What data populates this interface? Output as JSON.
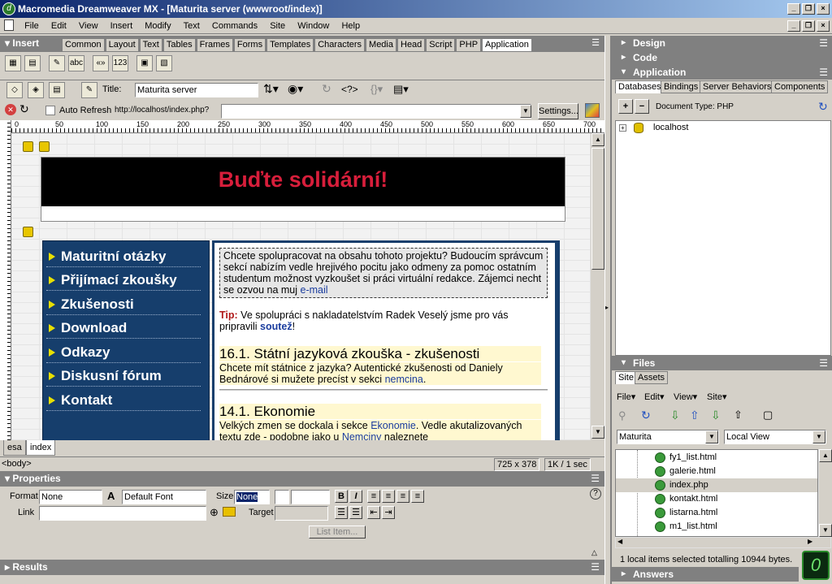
{
  "window": {
    "title": "Macromedia Dreamweaver MX - [Maturita server (wwwroot/index)]"
  },
  "menu": [
    "File",
    "Edit",
    "View",
    "Insert",
    "Modify",
    "Text",
    "Commands",
    "Site",
    "Window",
    "Help"
  ],
  "insert_panel": {
    "label": "Insert",
    "tabs": [
      "Common",
      "Layout",
      "Text",
      "Tables",
      "Frames",
      "Forms",
      "Templates",
      "Characters",
      "Media",
      "Head",
      "Script",
      "PHP",
      "Application"
    ],
    "selected_tab": "Application"
  },
  "doc_toolbar": {
    "title_label": "Title:",
    "title_value": "Maturita server"
  },
  "live_bar": {
    "auto_refresh_label": "Auto Refresh",
    "url": "http://localhost/index.php?",
    "settings_label": "Settings..."
  },
  "ruler": {
    "labels": [
      "0",
      "50",
      "100",
      "150",
      "200",
      "250",
      "300",
      "350",
      "400",
      "450",
      "500",
      "550",
      "600",
      "650",
      "700"
    ]
  },
  "page": {
    "banner_text": "Buďte solidární!",
    "nav": [
      "Maturitní otázky",
      "Přijímací zkoušky",
      "Zkušenosti",
      "Download",
      "Odkazy",
      "Diskusní fórum",
      "Kontakt"
    ],
    "notice_text": "Chcete spolupracovat na obsahu tohoto projektu? Budoucím správcum sekcí nabízím vedle hrejivého pocitu jako odmeny za pomoc ostatním studentum možnost vyzkoušet si práci virtuální redakce. Zájemci necht se ozvou na muj",
    "notice_link": "e-mail",
    "tip_label": "Tip:",
    "tip_text": "Ve spolupráci s nakladatelstvím Radek Veselý jsme pro vás pripravili",
    "tip_link": "soutež",
    "tip_end": "!",
    "news1_title": "16.1. Státní jazyková zkouška - zkušenosti",
    "news1_text": "Chcete mít státnice z jazyka? Autentické zkušenosti od Daniely Bednárové si mužete precíst v sekci",
    "news1_link": "nemcina",
    "news1_end": ".",
    "news2_title": "14.1. Ekonomie",
    "news2_text_a": "Velkých zmen se dockala i sekce",
    "news2_link_a": "Ekonomie",
    "news2_text_b": ". Vedle akutalizovaných textu zde - podobne jako u",
    "news2_link_b": "Nemciny",
    "news2_text_c": "naleznete"
  },
  "doc_tabs": [
    "esa",
    "index"
  ],
  "status": {
    "tag": "<body>",
    "size": "725 x 378",
    "speed": "1K / 1 sec"
  },
  "properties": {
    "header": "Properties",
    "format_label": "Format",
    "format_value": "None",
    "font_value": "Default Font",
    "size_label": "Size",
    "size_value": "None",
    "link_label": "Link",
    "target_label": "Target",
    "list_item_label": "List Item..."
  },
  "results_label": "Results",
  "right_panels": {
    "design": "Design",
    "code": "Code",
    "application": "Application",
    "app_tabs": [
      "Databases",
      "Bindings",
      "Server Behaviors",
      "Components"
    ],
    "doc_type": "Document Type: PHP",
    "db_item": "localhost",
    "files": "Files",
    "files_tabs": [
      "Site",
      "Assets"
    ],
    "files_menu": [
      "File",
      "Edit",
      "View",
      "Site"
    ],
    "site_name": "Maturita",
    "view_name": "Local View",
    "file_list": [
      "fy1_list.html",
      "galerie.html",
      "index.php",
      "kontakt.html",
      "listarna.html",
      "m1_list.html"
    ],
    "selected_file": "index.php",
    "status": "1 local items selected totalling 10944 bytes.",
    "answers": "Answers"
  }
}
